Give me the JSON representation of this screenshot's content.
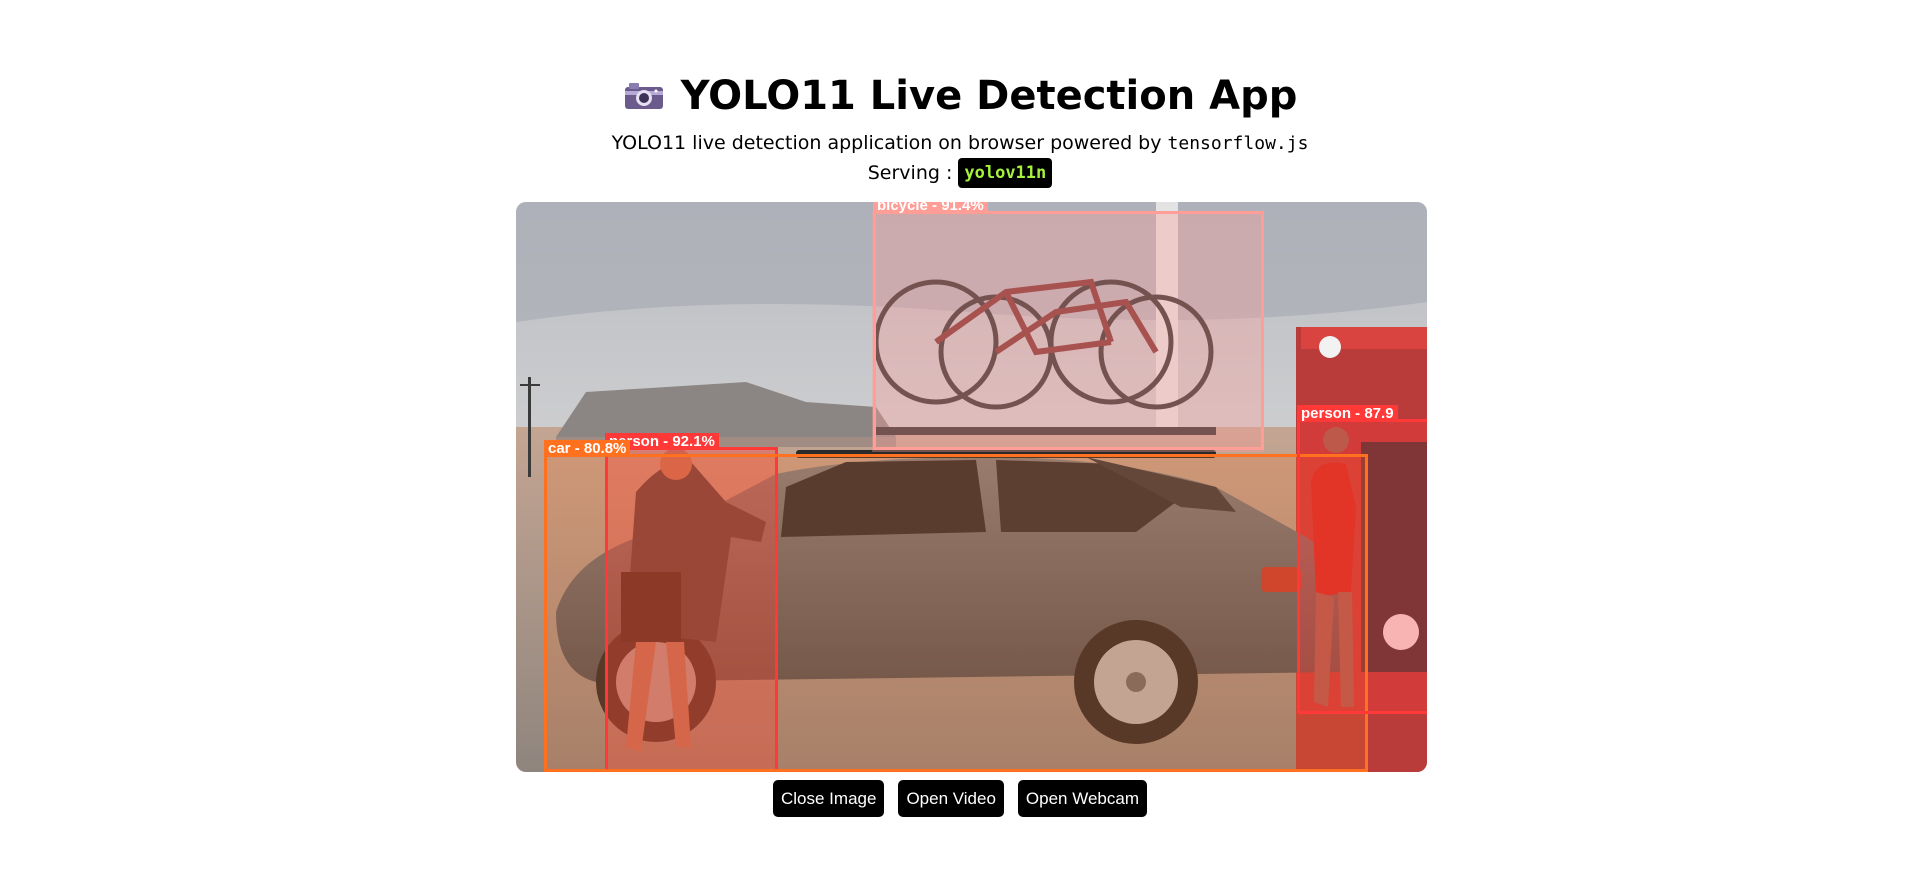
{
  "header": {
    "title": "YOLO11 Live Detection App",
    "subtitle_prefix": "YOLO11 live detection application on browser powered by ",
    "subtitle_code": "tensorflow.js",
    "serving_label": "Serving :",
    "model": "yolov11n"
  },
  "icons": {
    "camera": "camera-icon"
  },
  "detections": [
    {
      "label": "bicycle - 91.4%",
      "color": "#ff9d97"
    },
    {
      "label": "person - 92.1%",
      "color": "#ff3838"
    },
    {
      "label": "car - 80.8%",
      "color": "#ff701f"
    },
    {
      "label": "person - 87.9",
      "color": "#ff3838"
    }
  ],
  "buttons": {
    "close_image": "Close Image",
    "open_video": "Open Video",
    "open_webcam": "Open Webcam"
  }
}
